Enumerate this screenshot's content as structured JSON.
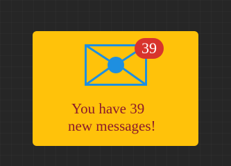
{
  "notification": {
    "icon": "envelope-icon",
    "badge_count": "39",
    "message_line_1": "You have 39",
    "message_line_2": "new messages!"
  },
  "colors": {
    "background": "#262626",
    "card": "#FFC20A",
    "envelope": "#1E8FE0",
    "badge": "#D8342D",
    "badge_text": "#FFFFFF",
    "message_text": "#8B1A2B"
  }
}
